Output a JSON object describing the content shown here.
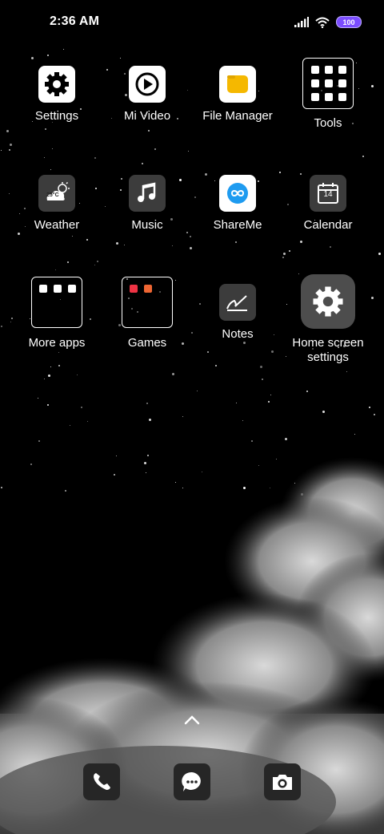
{
  "status_bar": {
    "time": "2:36 AM",
    "battery": "100",
    "icons": [
      "signal-icon",
      "wifi-icon",
      "battery-icon"
    ]
  },
  "apps": [
    {
      "label": "Settings",
      "icon": "gear-icon"
    },
    {
      "label": "Mi Video",
      "icon": "play-icon"
    },
    {
      "label": "File Manager",
      "icon": "folder-icon"
    },
    {
      "label": "Tools",
      "icon": "folder-grid-icon"
    },
    {
      "label": "Weather",
      "icon": "weather-icon",
      "temperature": "25°C"
    },
    {
      "label": "Music",
      "icon": "music-note-icon"
    },
    {
      "label": "ShareMe",
      "icon": "infinity-icon"
    },
    {
      "label": "Calendar",
      "icon": "calendar-icon",
      "day": "14"
    },
    {
      "label": "More apps",
      "icon": "folder-grid-icon"
    },
    {
      "label": "Games",
      "icon": "folder-grid-icon"
    },
    {
      "label": "Notes",
      "icon": "notes-icon"
    },
    {
      "label": "Home screen settings",
      "label_line1": "Home screen",
      "label_line2": "settings",
      "icon": "gear-icon"
    }
  ],
  "dock": [
    {
      "name": "phone",
      "icon": "phone-icon"
    },
    {
      "name": "messages",
      "icon": "chat-bubble-icon"
    },
    {
      "name": "camera",
      "icon": "camera-icon"
    }
  ],
  "colors": {
    "background": "#000000",
    "battery": "#7b4dff",
    "file_manager_accent": "#f5b800",
    "shareme_accent": "#1e9bf0"
  }
}
